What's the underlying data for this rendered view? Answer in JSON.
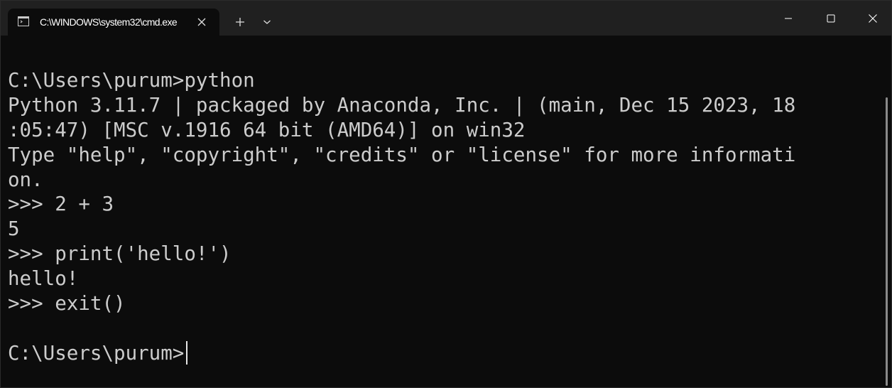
{
  "titlebar": {
    "tab_title": "C:\\WINDOWS\\system32\\cmd.exe",
    "tab_icon": "cmd-icon",
    "close_tab_icon": "close-icon",
    "new_tab_icon": "plus-icon",
    "dropdown_icon": "chevron-down-icon",
    "window_controls": [
      "minimize-icon",
      "maximize-icon",
      "close-icon"
    ]
  },
  "terminal": {
    "lines": [
      "",
      "C:\\Users\\purum>python",
      "Python 3.11.7 | packaged by Anaconda, Inc. | (main, Dec 15 2023, 18",
      ":05:47) [MSC v.1916 64 bit (AMD64)] on win32",
      "Type \"help\", \"copyright\", \"credits\" or \"license\" for more informati",
      "on.",
      ">>> 2 + 3",
      "5",
      ">>> print('hello!')",
      "hello!",
      ">>> exit()",
      "",
      "C:\\Users\\purum>"
    ]
  },
  "colors": {
    "background": "#0c0c0c",
    "titlebar": "#202020",
    "text": "#cccccc"
  }
}
